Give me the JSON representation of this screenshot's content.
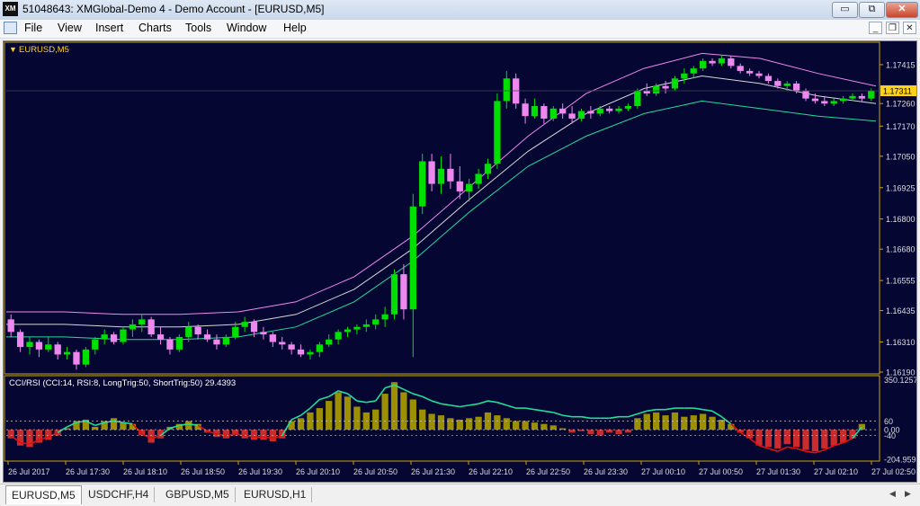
{
  "window": {
    "title": "51048643: XMGlobal-Demo 4 - Demo Account - [EURUSD,M5]",
    "logo": "XM",
    "minimize": "▭",
    "maximize": "⧉",
    "close": "✕"
  },
  "menu": {
    "items": [
      "File",
      "View",
      "Insert",
      "Charts",
      "Tools",
      "Window",
      "Help"
    ],
    "mdi_minimize": "_",
    "mdi_restore": "❐",
    "mdi_close": "✕"
  },
  "chart": {
    "symbol_label": "EURUSD,M5",
    "bid_price": "1.17311",
    "colors": {
      "background": "#060633",
      "grid_border": "#c8a800",
      "bull": "#00e000",
      "bear": "#ee88ee",
      "band_upper": "#ee88ee",
      "band_mid": "#d6d6d6",
      "band_lower": "#22dd99",
      "price_label_bg": "#ffd21a",
      "hist_pos": "#9c9000",
      "hist_neg": "#cc2b2b",
      "rsi_up": "#22dd99",
      "rsi_down": "#e01010"
    },
    "price_ticks": [
      "1.17415",
      "1.17260",
      "1.17170",
      "1.17050",
      "1.16925",
      "1.16800",
      "1.16680",
      "1.16555",
      "1.16435",
      "1.16310",
      "1.16190"
    ],
    "indicator_label": "CCI/RSI (CCI:14, RSI:8, LongTrig:50, ShortTrig:50) 29.4393",
    "indicator_ticks": [
      "350.1257",
      "60",
      "0.00",
      "-40",
      "-204.9599"
    ],
    "time_ticks": [
      "26 Jul 2017",
      "26 Jul 17:30",
      "26 Jul 18:10",
      "26 Jul 18:50",
      "26 Jul 19:30",
      "26 Jul 20:10",
      "26 Jul 20:50",
      "26 Jul 21:30",
      "26 Jul 22:10",
      "26 Jul 22:50",
      "26 Jul 23:30",
      "27 Jul 00:10",
      "27 Jul 00:50",
      "27 Jul 01:30",
      "27 Jul 02:10",
      "27 Jul 02:50"
    ]
  },
  "chart_data": {
    "type": "candlestick",
    "title": "EURUSD,M5",
    "ylim": [
      1.1619,
      1.1749
    ],
    "x": [
      "26 Jul 2017",
      "26 Jul 17:30",
      "26 Jul 18:10",
      "26 Jul 18:50",
      "26 Jul 19:30",
      "26 Jul 20:10",
      "26 Jul 20:50",
      "26 Jul 21:30",
      "26 Jul 22:10",
      "26 Jul 22:50",
      "26 Jul 23:30",
      "27 Jul 00:10",
      "27 Jul 00:50",
      "27 Jul 01:30",
      "27 Jul 02:10",
      "27 Jul 02:50"
    ],
    "last_price": 1.17311,
    "candles": [
      [
        1.164,
        1.1642,
        1.1633,
        1.1635
      ],
      [
        1.1635,
        1.1636,
        1.1627,
        1.1629
      ],
      [
        1.1629,
        1.1633,
        1.1626,
        1.1631
      ],
      [
        1.1631,
        1.1632,
        1.1625,
        1.1628
      ],
      [
        1.1628,
        1.1633,
        1.1627,
        1.163
      ],
      [
        1.163,
        1.1631,
        1.1624,
        1.1626
      ],
      [
        1.1626,
        1.1629,
        1.1624,
        1.1627
      ],
      [
        1.1627,
        1.1628,
        1.162,
        1.1622
      ],
      [
        1.1622,
        1.1629,
        1.1621,
        1.1628
      ],
      [
        1.1628,
        1.1633,
        1.1626,
        1.1632
      ],
      [
        1.1632,
        1.1636,
        1.163,
        1.1634
      ],
      [
        1.1634,
        1.1635,
        1.163,
        1.1631
      ],
      [
        1.1631,
        1.1637,
        1.163,
        1.1636
      ],
      [
        1.1636,
        1.164,
        1.1633,
        1.1638
      ],
      [
        1.1638,
        1.1642,
        1.1635,
        1.164
      ],
      [
        1.164,
        1.1641,
        1.1633,
        1.1634
      ],
      [
        1.1634,
        1.1637,
        1.163,
        1.1632
      ],
      [
        1.1632,
        1.1633,
        1.1626,
        1.1628
      ],
      [
        1.1628,
        1.1634,
        1.1627,
        1.1633
      ],
      [
        1.1633,
        1.1639,
        1.1631,
        1.1637
      ],
      [
        1.1637,
        1.1638,
        1.1632,
        1.1634
      ],
      [
        1.1634,
        1.1636,
        1.1631,
        1.1632
      ],
      [
        1.1632,
        1.1634,
        1.1628,
        1.163
      ],
      [
        1.163,
        1.1634,
        1.1629,
        1.1633
      ],
      [
        1.1633,
        1.1639,
        1.1632,
        1.1637
      ],
      [
        1.1637,
        1.1641,
        1.1635,
        1.1639
      ],
      [
        1.1639,
        1.164,
        1.1633,
        1.1635
      ],
      [
        1.1635,
        1.1637,
        1.1632,
        1.1634
      ],
      [
        1.1634,
        1.1635,
        1.1629,
        1.1631
      ],
      [
        1.1631,
        1.1633,
        1.1628,
        1.163
      ],
      [
        1.163,
        1.1631,
        1.1626,
        1.1628
      ],
      [
        1.1628,
        1.163,
        1.1625,
        1.1626
      ],
      [
        1.1626,
        1.1628,
        1.1624,
        1.1627
      ],
      [
        1.1627,
        1.1631,
        1.1625,
        1.163
      ],
      [
        1.163,
        1.1634,
        1.1629,
        1.1632
      ],
      [
        1.1632,
        1.1636,
        1.163,
        1.1635
      ],
      [
        1.1635,
        1.1637,
        1.1633,
        1.1636
      ],
      [
        1.1636,
        1.1638,
        1.1634,
        1.1637
      ],
      [
        1.1637,
        1.164,
        1.1635,
        1.1638
      ],
      [
        1.1638,
        1.1642,
        1.1636,
        1.164
      ],
      [
        1.164,
        1.1645,
        1.1637,
        1.1642
      ],
      [
        1.1642,
        1.166,
        1.164,
        1.1658
      ],
      [
        1.1658,
        1.1662,
        1.164,
        1.1644
      ],
      [
        1.1644,
        1.169,
        1.1625,
        1.1685
      ],
      [
        1.1685,
        1.1706,
        1.1682,
        1.1703
      ],
      [
        1.1703,
        1.1706,
        1.1691,
        1.1694
      ],
      [
        1.1694,
        1.1705,
        1.169,
        1.17
      ],
      [
        1.17,
        1.1706,
        1.1692,
        1.1695
      ],
      [
        1.1695,
        1.1701,
        1.1688,
        1.1691
      ],
      [
        1.1691,
        1.1696,
        1.1687,
        1.1694
      ],
      [
        1.1694,
        1.17,
        1.1692,
        1.1698
      ],
      [
        1.1698,
        1.1704,
        1.1696,
        1.1702
      ],
      [
        1.1702,
        1.173,
        1.17,
        1.1727
      ],
      [
        1.1727,
        1.1739,
        1.1724,
        1.1736
      ],
      [
        1.1736,
        1.1738,
        1.1724,
        1.1726
      ],
      [
        1.1726,
        1.1728,
        1.1718,
        1.1721
      ],
      [
        1.1721,
        1.1728,
        1.172,
        1.1725
      ],
      [
        1.1725,
        1.1726,
        1.1718,
        1.172
      ],
      [
        1.172,
        1.1725,
        1.1719,
        1.1724
      ],
      [
        1.1724,
        1.1726,
        1.172,
        1.1722
      ],
      [
        1.1722,
        1.1725,
        1.1718,
        1.172
      ],
      [
        1.172,
        1.1724,
        1.1719,
        1.1723
      ],
      [
        1.1723,
        1.1725,
        1.172,
        1.1722
      ],
      [
        1.1722,
        1.1725,
        1.1721,
        1.1724
      ],
      [
        1.1724,
        1.1725,
        1.1722,
        1.1723
      ],
      [
        1.1723,
        1.1725,
        1.1722,
        1.1724
      ],
      [
        1.1724,
        1.1726,
        1.1723,
        1.1725
      ],
      [
        1.1725,
        1.1732,
        1.1724,
        1.1731
      ],
      [
        1.1731,
        1.1734,
        1.1729,
        1.173
      ],
      [
        1.173,
        1.1734,
        1.1729,
        1.1733
      ],
      [
        1.1733,
        1.1735,
        1.173,
        1.1732
      ],
      [
        1.1732,
        1.1737,
        1.1731,
        1.1736
      ],
      [
        1.1736,
        1.174,
        1.1734,
        1.1738
      ],
      [
        1.1738,
        1.1741,
        1.1736,
        1.174
      ],
      [
        1.174,
        1.1744,
        1.1739,
        1.1743
      ],
      [
        1.1743,
        1.1744,
        1.1741,
        1.1742
      ],
      [
        1.1742,
        1.1745,
        1.1741,
        1.1744
      ],
      [
        1.1744,
        1.1745,
        1.174,
        1.1741
      ],
      [
        1.1741,
        1.1742,
        1.1738,
        1.1739
      ],
      [
        1.1739,
        1.174,
        1.1737,
        1.1738
      ],
      [
        1.1738,
        1.1739,
        1.1736,
        1.1737
      ],
      [
        1.1737,
        1.1738,
        1.1734,
        1.1735
      ],
      [
        1.1735,
        1.1736,
        1.1732,
        1.1733
      ],
      [
        1.1733,
        1.1735,
        1.1731,
        1.1734
      ],
      [
        1.1734,
        1.1735,
        1.173,
        1.1731
      ],
      [
        1.1731,
        1.1732,
        1.1727,
        1.1728
      ],
      [
        1.1728,
        1.173,
        1.1726,
        1.1727
      ],
      [
        1.1727,
        1.1729,
        1.1725,
        1.1726
      ],
      [
        1.1726,
        1.1728,
        1.1725,
        1.1727
      ],
      [
        1.1727,
        1.1729,
        1.1726,
        1.1728
      ],
      [
        1.1728,
        1.173,
        1.1727,
        1.1729
      ],
      [
        1.1729,
        1.173,
        1.1727,
        1.1728
      ],
      [
        1.1728,
        1.1732,
        1.1727,
        1.17311
      ]
    ],
    "band_upper": [
      1.1643,
      1.1643,
      1.1642,
      1.1642,
      1.1643,
      1.1647,
      1.1657,
      1.1673,
      1.1693,
      1.1713,
      1.173,
      1.174,
      1.1746,
      1.1744,
      1.1738,
      1.1733
    ],
    "band_mid": [
      1.1638,
      1.1638,
      1.1637,
      1.1637,
      1.1638,
      1.1642,
      1.1652,
      1.1668,
      1.1688,
      1.1707,
      1.1722,
      1.1732,
      1.1737,
      1.1734,
      1.1729,
      1.1726
    ],
    "band_lower": [
      1.1633,
      1.1633,
      1.1632,
      1.1632,
      1.1633,
      1.1637,
      1.1647,
      1.1663,
      1.1683,
      1.1701,
      1.1713,
      1.1722,
      1.1727,
      1.1724,
      1.1721,
      1.1719
    ],
    "indicator": {
      "name": "CCI/RSI (CCI:14, RSI:8, LongTrig:50, ShortTrig:50)",
      "last_value": 29.4393,
      "ylim": [
        -204.9599,
        350.1257
      ],
      "levels": [
        60,
        0,
        -40
      ],
      "hist": [
        -60,
        -110,
        -120,
        -90,
        -70,
        -40,
        10,
        60,
        70,
        20,
        60,
        80,
        50,
        40,
        -40,
        -90,
        -60,
        20,
        40,
        60,
        40,
        -20,
        -50,
        -60,
        -40,
        -60,
        -70,
        -70,
        -80,
        -60,
        60,
        80,
        120,
        150,
        200,
        260,
        230,
        160,
        120,
        140,
        250,
        330,
        260,
        210,
        140,
        110,
        100,
        80,
        70,
        80,
        90,
        120,
        100,
        80,
        60,
        60,
        50,
        40,
        30,
        10,
        -20,
        -10,
        -30,
        -40,
        -20,
        -30,
        -20,
        80,
        110,
        120,
        100,
        120,
        90,
        100,
        110,
        90,
        70,
        40,
        -20,
        -60,
        -110,
        -120,
        -130,
        -100,
        -120,
        -140,
        -150,
        -130,
        -110,
        -90,
        -60,
        40
      ],
      "line": [
        -40,
        -90,
        -100,
        -70,
        -50,
        -20,
        20,
        50,
        60,
        30,
        50,
        60,
        50,
        40,
        -30,
        -60,
        -40,
        10,
        30,
        40,
        30,
        -10,
        -30,
        -40,
        -30,
        -40,
        -50,
        -50,
        -60,
        -40,
        70,
        100,
        150,
        210,
        230,
        270,
        250,
        200,
        190,
        200,
        290,
        310,
        280,
        250,
        230,
        200,
        180,
        170,
        160,
        170,
        180,
        200,
        190,
        170,
        150,
        150,
        140,
        130,
        120,
        100,
        90,
        90,
        80,
        80,
        80,
        90,
        90,
        110,
        130,
        140,
        140,
        150,
        150,
        150,
        140,
        130,
        90,
        40,
        -20,
        -60,
        -110,
        -130,
        -150,
        -120,
        -130,
        -150,
        -160,
        -140,
        -110,
        -90,
        -60,
        20
      ]
    }
  }
}
